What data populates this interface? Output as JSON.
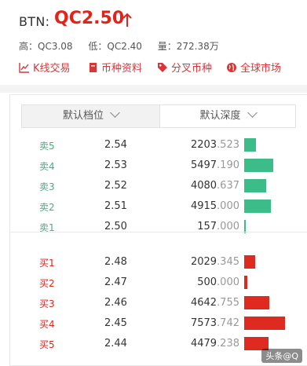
{
  "header": {
    "pair": "BTN:",
    "price": "QC2.50",
    "high_label": "高：QC3.08",
    "low_label": "低：QC2.40",
    "volume_label": "量：272.38万"
  },
  "links": [
    {
      "label": "K线交易",
      "icon": "chart-line-icon"
    },
    {
      "label": "币种资料",
      "icon": "book-icon"
    },
    {
      "label": "分叉币种",
      "icon": "tag-icon"
    },
    {
      "label": "全球市场",
      "icon": "globe-icon"
    }
  ],
  "tabs": {
    "left": "默认档位",
    "right": "默认深度"
  },
  "sell_orders": [
    {
      "label": "卖5",
      "price": "2.54",
      "volume_int": "2203",
      "volume_dec": ".523",
      "depth": 0.29
    },
    {
      "label": "卖4",
      "price": "2.53",
      "volume_int": "5497",
      "volume_dec": ".190",
      "depth": 0.72
    },
    {
      "label": "卖3",
      "price": "2.52",
      "volume_int": "4080",
      "volume_dec": ".637",
      "depth": 0.54
    },
    {
      "label": "卖2",
      "price": "2.51",
      "volume_int": "4915",
      "volume_dec": ".000",
      "depth": 0.65
    },
    {
      "label": "卖1",
      "price": "2.50",
      "volume_int": "157",
      "volume_dec": ".000",
      "depth": 0.03
    }
  ],
  "buy_orders": [
    {
      "label": "买1",
      "price": "2.48",
      "volume_int": "2029",
      "volume_dec": ".345",
      "depth": 0.27
    },
    {
      "label": "买2",
      "price": "2.47",
      "volume_int": "500",
      "volume_dec": ".000",
      "depth": 0.07
    },
    {
      "label": "买3",
      "price": "2.46",
      "volume_int": "4642",
      "volume_dec": ".755",
      "depth": 0.61
    },
    {
      "label": "买4",
      "price": "2.45",
      "volume_int": "7573",
      "volume_dec": ".742",
      "depth": 1.0
    },
    {
      "label": "买5",
      "price": "2.44",
      "volume_int": "4479",
      "volume_dec": ".238",
      "depth": 0.59
    }
  ],
  "watermark": "头条@Q",
  "colors": {
    "accent": "#e2231a",
    "sell": "#3cbc88",
    "buy": "#df2a22"
  }
}
